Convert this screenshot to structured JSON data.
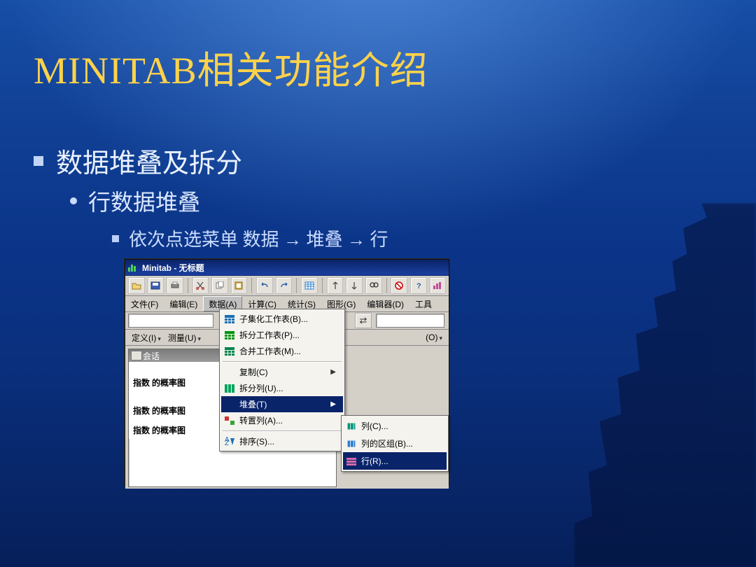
{
  "slide": {
    "title": "MINITAB相关功能介绍",
    "bullet1": "数据堆叠及拆分",
    "bullet2": "行数据堆叠",
    "bullet3_prefix": "依次点选菜单 数据 ",
    "bullet3_mid": " 堆叠 ",
    "bullet3_suffix": " 行",
    "arrow": "→"
  },
  "minitab": {
    "title": "Minitab - 无标题",
    "menubar": [
      "文件(F)",
      "编辑(E)",
      "数据(A)",
      "计算(C)",
      "统计(S)",
      "图形(G)",
      "编辑器(D)",
      "工具"
    ],
    "defrow": {
      "define": "定义(I)",
      "measure": "测量(U)",
      "extra": "(O)"
    },
    "session_title": "会话",
    "session_rows": [
      "指数 的概率图",
      "指数 的概率图"
    ],
    "session_partial": "指数 的概率图",
    "dropdown": {
      "subset": "子集化工作表(B)...",
      "split": "拆分工作表(P)...",
      "merge": "合并工作表(M)...",
      "copy": "复制(C)",
      "splitcol": "拆分列(U)...",
      "stack": "堆叠(T)",
      "transpose": "转置列(A)...",
      "sort": "排序(S)..."
    },
    "submenu": {
      "col": "列(C)...",
      "colgroup": "列的区组(B)...",
      "row": "行(R)..."
    }
  }
}
